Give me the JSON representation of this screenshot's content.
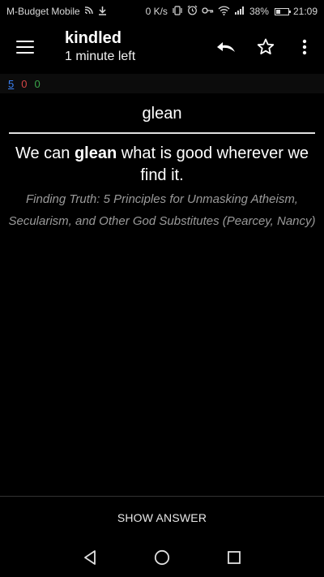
{
  "status_bar": {
    "carrier": "M-Budget Mobile",
    "speed": "0 K/s",
    "battery": "38%",
    "battery_level": 0.38,
    "time": "21:09"
  },
  "toolbar": {
    "title": "kindled",
    "subtitle": "1 minute left",
    "icons": [
      "menu-icon",
      "undo-icon",
      "star-icon",
      "more-vert-icon"
    ]
  },
  "counts": {
    "new": "5",
    "learning": "0",
    "review": "0",
    "colors": {
      "new": "#3b82f6",
      "learning": "#d64545",
      "review": "#3aa64a"
    }
  },
  "card": {
    "question": "glean",
    "sentence_before": "We can ",
    "sentence_keyword": "glean",
    "sentence_after": " what is good wherever we find it.",
    "source": "Finding Truth: 5 Principles for Unmasking Atheism, Secularism, and Other God Substitutes (Pearcey, Nancy)"
  },
  "answer_button": {
    "label": "SHOW ANSWER"
  },
  "nav_bar": {
    "icons": [
      "back-icon",
      "home-icon",
      "recents-icon"
    ]
  }
}
